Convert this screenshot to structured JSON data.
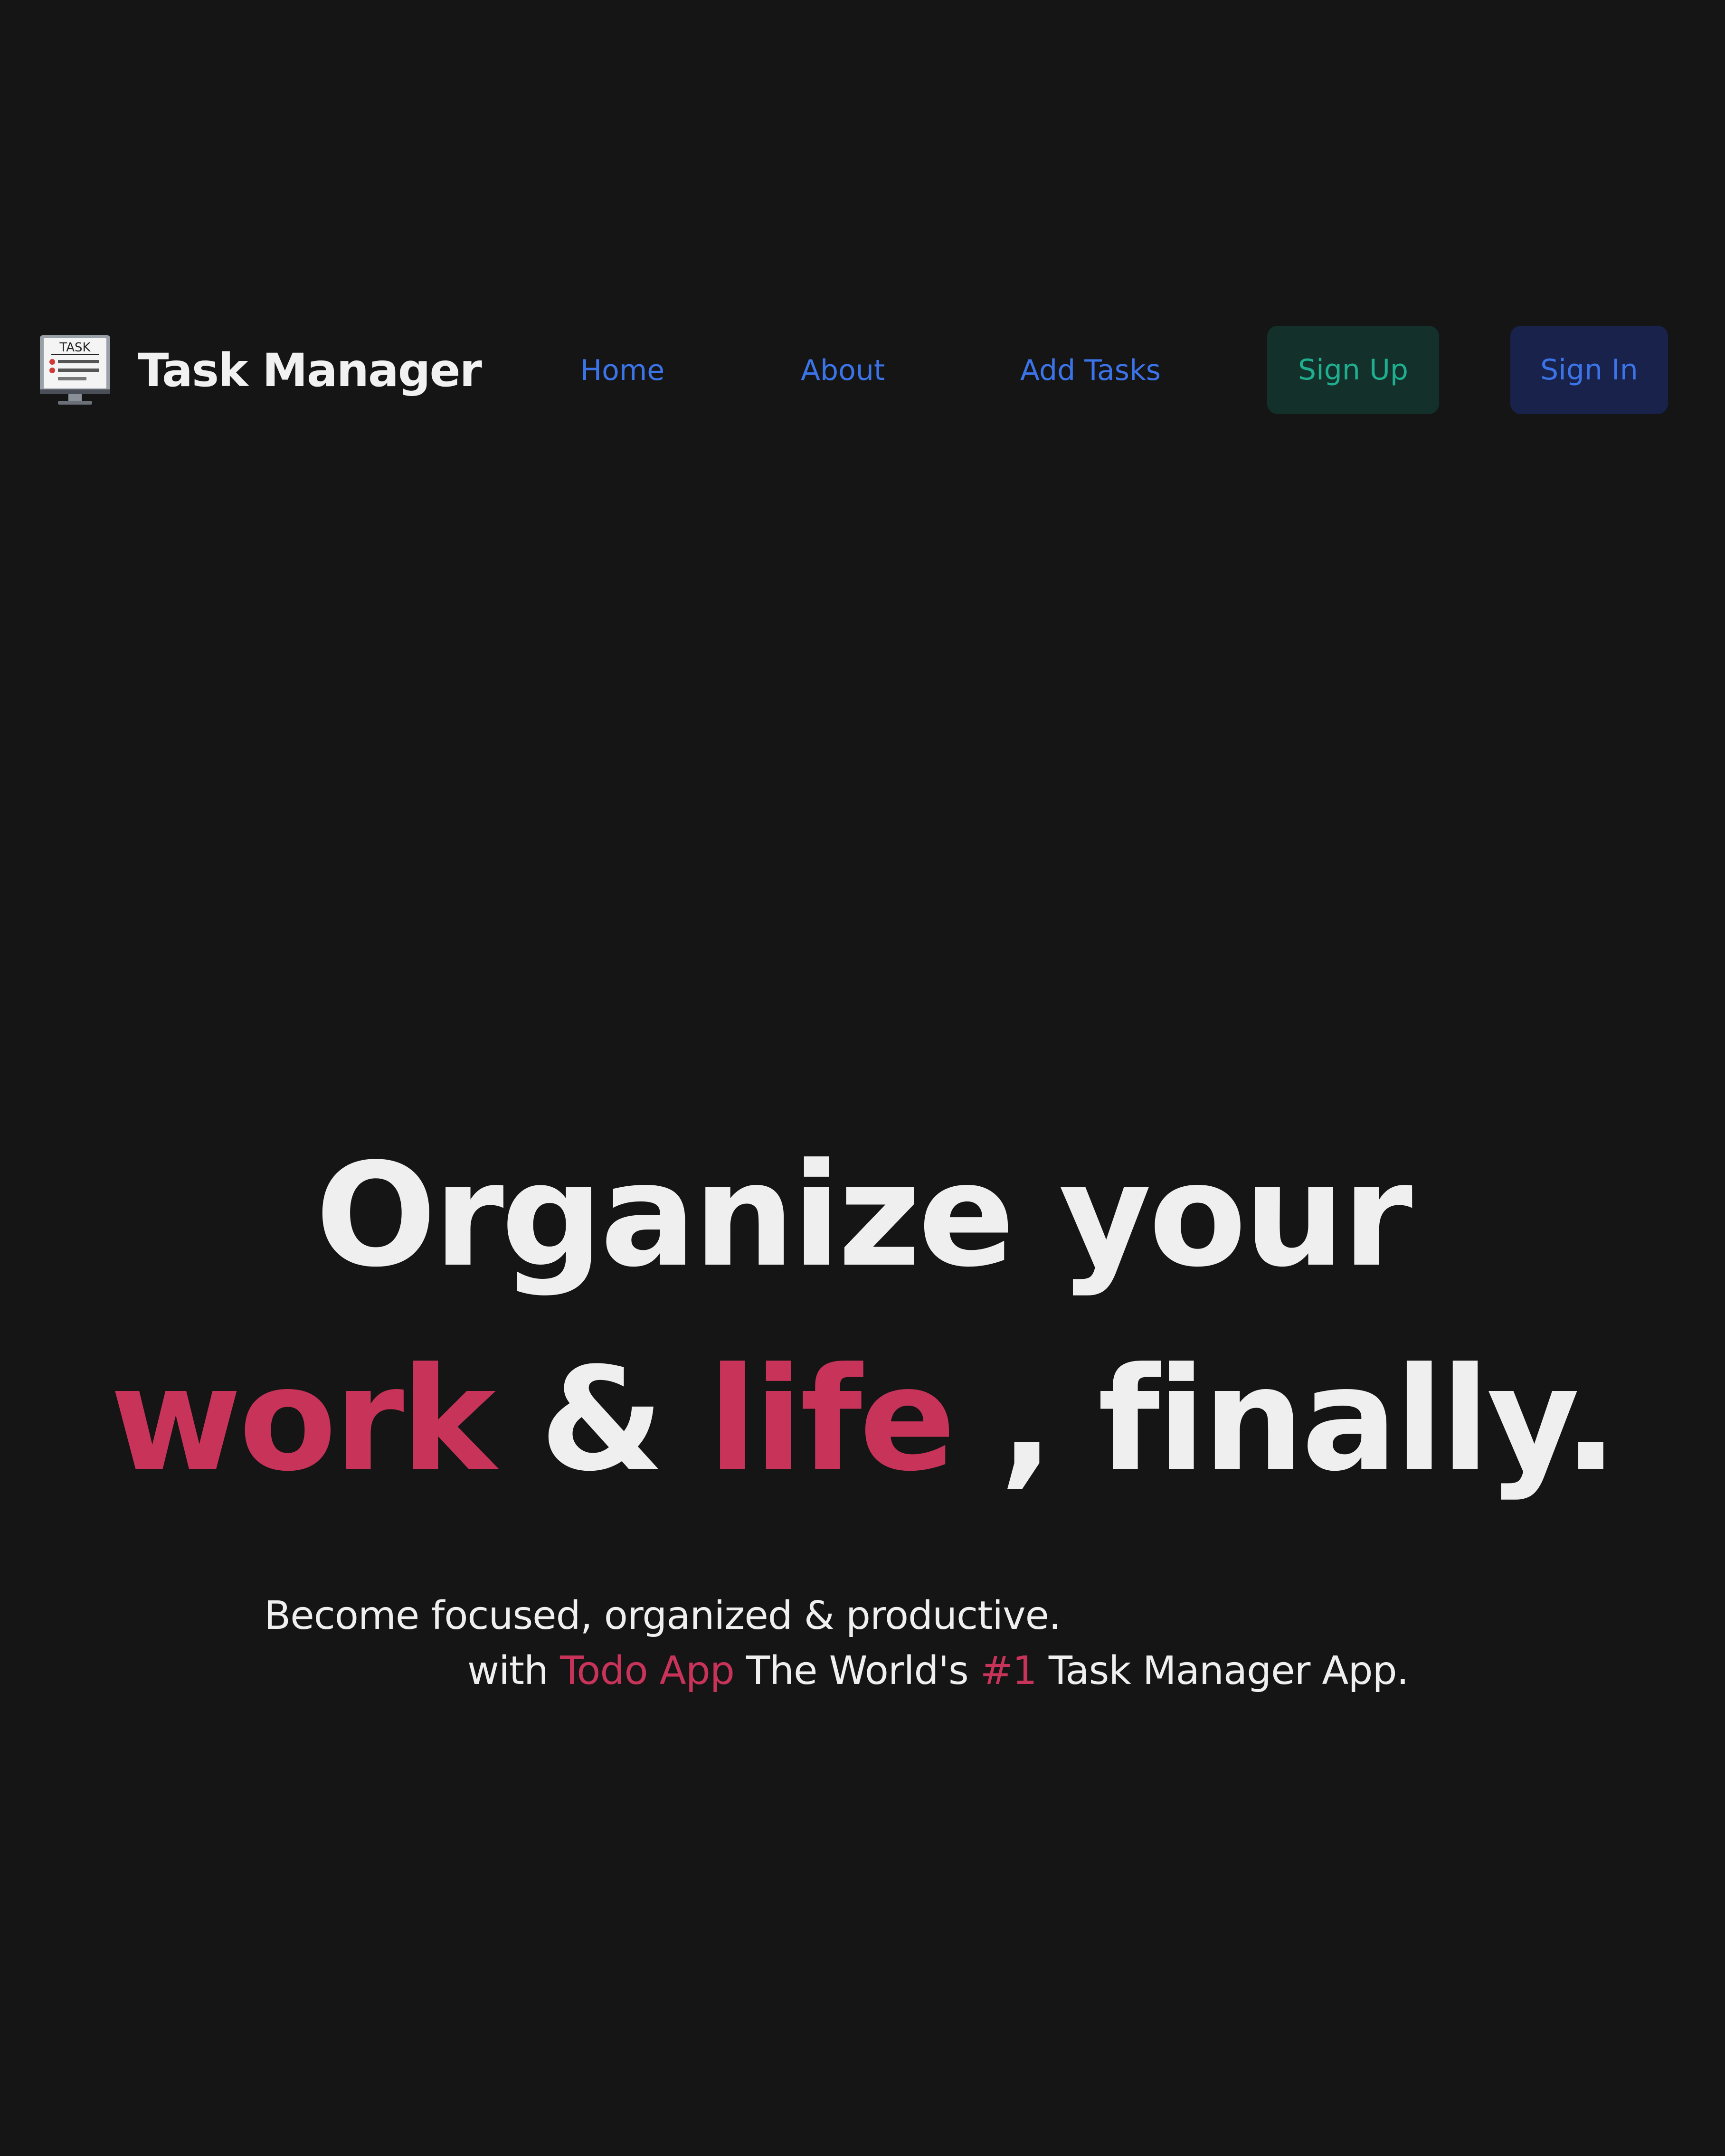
{
  "navbar": {
    "logo_icon": "task-monitor-icon",
    "logo_text": "TASK",
    "brand_title": "Task Manager",
    "links": {
      "home": "Home",
      "about": "About",
      "add_tasks": "Add Tasks"
    },
    "sign_up": "Sign Up",
    "sign_in": "Sign In"
  },
  "hero": {
    "line1": "Organize your",
    "line2": {
      "word_work": "work",
      "amp": "&",
      "word_life": "life",
      "rest": ", finally."
    },
    "sub1": "Become focused, organized & productive.",
    "sub2": {
      "with": "with",
      "todo_app": "Todo App",
      "middle": "The World's",
      "rank": "#1",
      "end": "Task Manager App."
    }
  },
  "colors": {
    "background": "#151516",
    "text": "#efefef",
    "accent": "#c8335a",
    "link": "#3b73e8",
    "signup_bg": "#13302b",
    "signup_text": "#1fae8e",
    "signin_bg": "#18224a"
  }
}
